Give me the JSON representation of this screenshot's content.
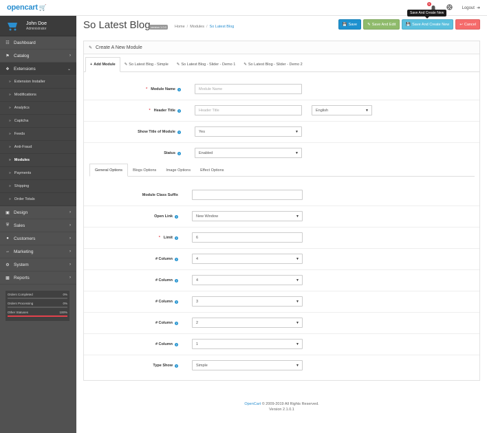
{
  "header": {
    "logo_text": "opencart",
    "notification_count": "5",
    "logout_label": "Logout",
    "tooltip": "Save And Create New"
  },
  "profile": {
    "name": "John Doe",
    "role": "Administrator"
  },
  "sidebar": {
    "items": [
      {
        "label": "Dashboard",
        "icon": "dashboard-icon"
      },
      {
        "label": "Catalog",
        "icon": "tag-icon"
      },
      {
        "label": "Extensions",
        "icon": "puzzle-icon"
      },
      {
        "label": "Design",
        "icon": "monitor-icon"
      },
      {
        "label": "Sales",
        "icon": "cart-icon"
      },
      {
        "label": "Customers",
        "icon": "user-icon"
      },
      {
        "label": "Marketing",
        "icon": "share-icon"
      },
      {
        "label": "System",
        "icon": "gear-icon"
      },
      {
        "label": "Reports",
        "icon": "chart-icon"
      }
    ],
    "sub_items": [
      "Extension Installer",
      "Modifications",
      "Analytics",
      "Captcha",
      "Feeds",
      "Anti-Fraud",
      "Modules",
      "Payments",
      "Shipping",
      "Order Totals"
    ],
    "stats": [
      {
        "label": "Orders Completed",
        "value": "0%",
        "fill": 0,
        "color": "#8fbb6c"
      },
      {
        "label": "Orders Processing",
        "value": "0%",
        "fill": 0,
        "color": "#f0ad4e"
      },
      {
        "label": "Other Statuses",
        "value": "100%",
        "fill": 1,
        "color": "#e4424c"
      }
    ]
  },
  "page": {
    "title": "So Latest Blog",
    "version": "version 1.0.0",
    "breadcrumb": [
      "Home",
      "Modules",
      "So Latest Blog"
    ],
    "buttons": {
      "save": "Save",
      "save_edit": "Save And Edit",
      "save_new": "Save And Create New",
      "cancel": "Cancel"
    }
  },
  "panel": {
    "heading": "Create A New Module",
    "tabs": [
      "Add Module",
      "So Latest Blog - Simple",
      "So Latest Blog - Slider - Demo 1",
      "So Latest Blog - Slider - Demo 2"
    ]
  },
  "form": {
    "module_name": {
      "label": "Module Name",
      "placeholder": "Module Name"
    },
    "header_title": {
      "label": "Header Title",
      "placeholder": "Header Title",
      "language": "English"
    },
    "show_title": {
      "label": "Show Title of Module",
      "value": "Yes"
    },
    "status": {
      "label": "Status",
      "value": "Enabled"
    }
  },
  "options_tabs": [
    "General Options",
    "Blogs Options",
    "Image Options",
    "Effect Options"
  ],
  "general": {
    "class_suffix": {
      "label": "Module Class Suffix",
      "value": ""
    },
    "open_link": {
      "label": "Open Link",
      "value": "New Window"
    },
    "limit": {
      "label": "Limit",
      "value": "6"
    },
    "columns": [
      {
        "label": "# Column",
        "value": "4"
      },
      {
        "label": "# Column",
        "value": "4"
      },
      {
        "label": "# Column",
        "value": "3"
      },
      {
        "label": "# Column",
        "value": "2"
      },
      {
        "label": "# Column",
        "value": "1"
      }
    ],
    "type_show": {
      "label": "Type Show",
      "value": "Simple"
    }
  },
  "footer": {
    "brand": "OpenCart",
    "copyright": "© 2009-2019 All Rights Reserved.",
    "version": "Version 2.1.0.1"
  }
}
